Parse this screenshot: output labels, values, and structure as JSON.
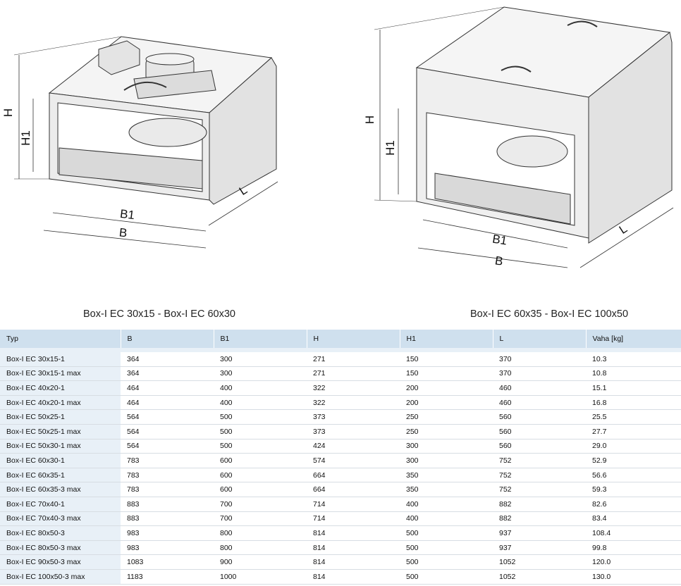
{
  "captions": {
    "left": "Box-I EC 30x15 - Box-I EC 60x30",
    "right": "Box-I EC 60x35 - Box-I EC 100x50"
  },
  "dimension_labels": {
    "h": "H",
    "h1": "H1",
    "b": "B",
    "b1": "B1",
    "l": "L"
  },
  "table": {
    "headers": [
      "Typ",
      "B",
      "B1",
      "H",
      "H1",
      "L",
      "Vaha [kg]"
    ],
    "rows": [
      [
        "Box-I EC 30x15-1",
        "364",
        "300",
        "271",
        "150",
        "370",
        "10.3"
      ],
      [
        "Box-I EC 30x15-1 max",
        "364",
        "300",
        "271",
        "150",
        "370",
        "10.8"
      ],
      [
        "Box-I EC 40x20-1",
        "464",
        "400",
        "322",
        "200",
        "460",
        "15.1"
      ],
      [
        "Box-I EC 40x20-1 max",
        "464",
        "400",
        "322",
        "200",
        "460",
        "16.8"
      ],
      [
        "Box-I EC 50x25-1",
        "564",
        "500",
        "373",
        "250",
        "560",
        "25.5"
      ],
      [
        "Box-I EC 50x25-1 max",
        "564",
        "500",
        "373",
        "250",
        "560",
        "27.7"
      ],
      [
        "Box-I EC 50x30-1 max",
        "564",
        "500",
        "424",
        "300",
        "560",
        "29.0"
      ],
      [
        "Box-I EC 60x30-1",
        "783",
        "600",
        "574",
        "300",
        "752",
        "52.9"
      ],
      [
        "Box-I EC 60x35-1",
        "783",
        "600",
        "664",
        "350",
        "752",
        "56.6"
      ],
      [
        "Box-I EC 60x35-3 max",
        "783",
        "600",
        "664",
        "350",
        "752",
        "59.3"
      ],
      [
        "Box-I EC 70x40-1",
        "883",
        "700",
        "714",
        "400",
        "882",
        "82.6"
      ],
      [
        "Box-I EC 70x40-3 max",
        "883",
        "700",
        "714",
        "400",
        "882",
        "83.4"
      ],
      [
        "Box-I EC 80x50-3",
        "983",
        "800",
        "814",
        "500",
        "937",
        "108.4"
      ],
      [
        "Box-I EC 80x50-3 max",
        "983",
        "800",
        "814",
        "500",
        "937",
        "99.8"
      ],
      [
        "Box-I EC 90x50-3 max",
        "1083",
        "900",
        "814",
        "500",
        "1052",
        "120.0"
      ],
      [
        "Box-I EC 100x50-3 max",
        "1183",
        "1000",
        "814",
        "500",
        "1052",
        "130.0"
      ]
    ]
  }
}
